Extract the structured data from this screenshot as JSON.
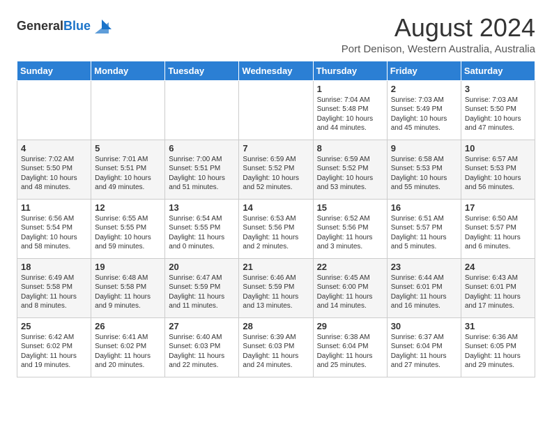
{
  "header": {
    "logo_general": "General",
    "logo_blue": "Blue",
    "month_year": "August 2024",
    "location": "Port Denison, Western Australia, Australia"
  },
  "weekdays": [
    "Sunday",
    "Monday",
    "Tuesday",
    "Wednesday",
    "Thursday",
    "Friday",
    "Saturday"
  ],
  "weeks": [
    [
      {
        "day": "",
        "info": ""
      },
      {
        "day": "",
        "info": ""
      },
      {
        "day": "",
        "info": ""
      },
      {
        "day": "",
        "info": ""
      },
      {
        "day": "1",
        "info": "Sunrise: 7:04 AM\nSunset: 5:48 PM\nDaylight: 10 hours\nand 44 minutes."
      },
      {
        "day": "2",
        "info": "Sunrise: 7:03 AM\nSunset: 5:49 PM\nDaylight: 10 hours\nand 45 minutes."
      },
      {
        "day": "3",
        "info": "Sunrise: 7:03 AM\nSunset: 5:50 PM\nDaylight: 10 hours\nand 47 minutes."
      }
    ],
    [
      {
        "day": "4",
        "info": "Sunrise: 7:02 AM\nSunset: 5:50 PM\nDaylight: 10 hours\nand 48 minutes."
      },
      {
        "day": "5",
        "info": "Sunrise: 7:01 AM\nSunset: 5:51 PM\nDaylight: 10 hours\nand 49 minutes."
      },
      {
        "day": "6",
        "info": "Sunrise: 7:00 AM\nSunset: 5:51 PM\nDaylight: 10 hours\nand 51 minutes."
      },
      {
        "day": "7",
        "info": "Sunrise: 6:59 AM\nSunset: 5:52 PM\nDaylight: 10 hours\nand 52 minutes."
      },
      {
        "day": "8",
        "info": "Sunrise: 6:59 AM\nSunset: 5:52 PM\nDaylight: 10 hours\nand 53 minutes."
      },
      {
        "day": "9",
        "info": "Sunrise: 6:58 AM\nSunset: 5:53 PM\nDaylight: 10 hours\nand 55 minutes."
      },
      {
        "day": "10",
        "info": "Sunrise: 6:57 AM\nSunset: 5:53 PM\nDaylight: 10 hours\nand 56 minutes."
      }
    ],
    [
      {
        "day": "11",
        "info": "Sunrise: 6:56 AM\nSunset: 5:54 PM\nDaylight: 10 hours\nand 58 minutes."
      },
      {
        "day": "12",
        "info": "Sunrise: 6:55 AM\nSunset: 5:55 PM\nDaylight: 10 hours\nand 59 minutes."
      },
      {
        "day": "13",
        "info": "Sunrise: 6:54 AM\nSunset: 5:55 PM\nDaylight: 11 hours\nand 0 minutes."
      },
      {
        "day": "14",
        "info": "Sunrise: 6:53 AM\nSunset: 5:56 PM\nDaylight: 11 hours\nand 2 minutes."
      },
      {
        "day": "15",
        "info": "Sunrise: 6:52 AM\nSunset: 5:56 PM\nDaylight: 11 hours\nand 3 minutes."
      },
      {
        "day": "16",
        "info": "Sunrise: 6:51 AM\nSunset: 5:57 PM\nDaylight: 11 hours\nand 5 minutes."
      },
      {
        "day": "17",
        "info": "Sunrise: 6:50 AM\nSunset: 5:57 PM\nDaylight: 11 hours\nand 6 minutes."
      }
    ],
    [
      {
        "day": "18",
        "info": "Sunrise: 6:49 AM\nSunset: 5:58 PM\nDaylight: 11 hours\nand 8 minutes."
      },
      {
        "day": "19",
        "info": "Sunrise: 6:48 AM\nSunset: 5:58 PM\nDaylight: 11 hours\nand 9 minutes."
      },
      {
        "day": "20",
        "info": "Sunrise: 6:47 AM\nSunset: 5:59 PM\nDaylight: 11 hours\nand 11 minutes."
      },
      {
        "day": "21",
        "info": "Sunrise: 6:46 AM\nSunset: 5:59 PM\nDaylight: 11 hours\nand 13 minutes."
      },
      {
        "day": "22",
        "info": "Sunrise: 6:45 AM\nSunset: 6:00 PM\nDaylight: 11 hours\nand 14 minutes."
      },
      {
        "day": "23",
        "info": "Sunrise: 6:44 AM\nSunset: 6:01 PM\nDaylight: 11 hours\nand 16 minutes."
      },
      {
        "day": "24",
        "info": "Sunrise: 6:43 AM\nSunset: 6:01 PM\nDaylight: 11 hours\nand 17 minutes."
      }
    ],
    [
      {
        "day": "25",
        "info": "Sunrise: 6:42 AM\nSunset: 6:02 PM\nDaylight: 11 hours\nand 19 minutes."
      },
      {
        "day": "26",
        "info": "Sunrise: 6:41 AM\nSunset: 6:02 PM\nDaylight: 11 hours\nand 20 minutes."
      },
      {
        "day": "27",
        "info": "Sunrise: 6:40 AM\nSunset: 6:03 PM\nDaylight: 11 hours\nand 22 minutes."
      },
      {
        "day": "28",
        "info": "Sunrise: 6:39 AM\nSunset: 6:03 PM\nDaylight: 11 hours\nand 24 minutes."
      },
      {
        "day": "29",
        "info": "Sunrise: 6:38 AM\nSunset: 6:04 PM\nDaylight: 11 hours\nand 25 minutes."
      },
      {
        "day": "30",
        "info": "Sunrise: 6:37 AM\nSunset: 6:04 PM\nDaylight: 11 hours\nand 27 minutes."
      },
      {
        "day": "31",
        "info": "Sunrise: 6:36 AM\nSunset: 6:05 PM\nDaylight: 11 hours\nand 29 minutes."
      }
    ]
  ]
}
